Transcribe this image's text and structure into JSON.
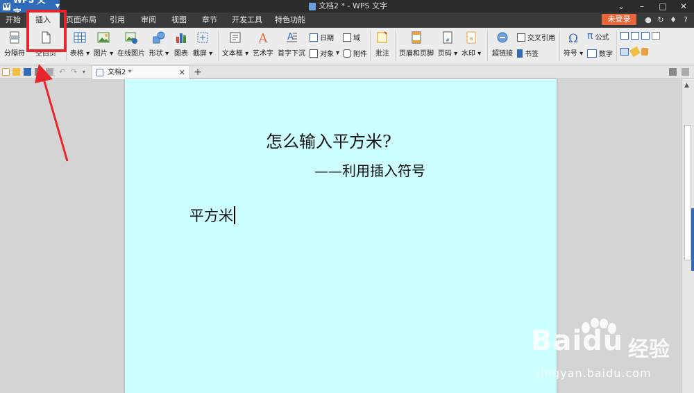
{
  "titlebar": {
    "app_name": "WPS 文字",
    "window_title": "文档2 * - WPS 文字",
    "min": "–",
    "max": "□",
    "close": "✕"
  },
  "menu": {
    "tabs": [
      "开始",
      "插入",
      "页面布局",
      "引用",
      "审阅",
      "视图",
      "章节",
      "开发工具",
      "特色功能"
    ],
    "active": "插入",
    "login": "未登录",
    "help": "?"
  },
  "ribbon": {
    "page_break": "分隔符",
    "blank_page": "空白页",
    "table": "表格",
    "picture": "图片",
    "online_picture": "在线图片",
    "shapes": "形状",
    "chart": "图表",
    "screenshot": "截屏",
    "textbox": "文本框",
    "wordart": "艺术字",
    "dropcap": "首字下沉",
    "date": "日期",
    "field": "域",
    "object": "对象",
    "attachment": "附件",
    "comment": "批注",
    "header_footer": "页眉和页脚",
    "page_number": "页码",
    "watermark": "水印",
    "hyperlink": "超链接",
    "cross_ref": "交叉引用",
    "bookmark": "书签",
    "symbol": "符号",
    "formula": "公式",
    "number": "数字"
  },
  "doc_tab": {
    "name": "文档2 *",
    "close": "✕",
    "new": "+"
  },
  "document": {
    "heading": "怎么输入平方米?",
    "subtitle": "——利用插入符号",
    "body": "平方米"
  },
  "watermark": {
    "brand": "Bai",
    "brand2": "du",
    "cn": "经验",
    "url": "jingyan.baidu.com"
  },
  "colors": {
    "page_bg": "#ccffff",
    "highlight": "#e8242c",
    "login_btn": "#e8673a",
    "accent": "#2f6bb8"
  }
}
